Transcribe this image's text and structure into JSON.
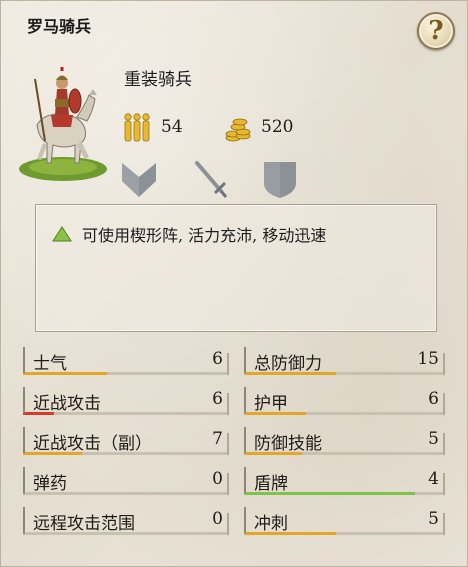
{
  "title": "罗马骑兵",
  "unit": {
    "name": "重装骑兵",
    "men": "54",
    "cost": "520",
    "class_icons": [
      "chevron-icon",
      "sword-icon",
      "shield-icon"
    ]
  },
  "ability": {
    "text": "可使用楔形阵, 活力充沛, 移动迅速",
    "color": "#7cb342"
  },
  "colors": {
    "bar_default": "#e3a62c",
    "bar_low": "#d93a2a",
    "bar_good": "#7cc44a"
  },
  "stats_left": [
    {
      "label": "士气",
      "value": "6",
      "fill": 0.4,
      "color": "#e3a62c"
    },
    {
      "label": "近战攻击",
      "value": "6",
      "fill": 0.14,
      "color": "#d93a2a"
    },
    {
      "label": "近战攻击（副）",
      "value": "7",
      "fill": 0.28,
      "color": "#e3a62c"
    },
    {
      "label": "弹药",
      "value": "0",
      "fill": 0.0,
      "color": "#e3a62c"
    },
    {
      "label": "远程攻击范围",
      "value": "0",
      "fill": 0.0,
      "color": "#e3a62c"
    }
  ],
  "stats_right": [
    {
      "label": "总防御力",
      "value": "15",
      "fill": 0.45,
      "color": "#e3a62c"
    },
    {
      "label": "护甲",
      "value": "6",
      "fill": 0.3,
      "color": "#e3a62c"
    },
    {
      "label": "防御技能",
      "value": "5",
      "fill": 0.28,
      "color": "#e3a62c"
    },
    {
      "label": "盾牌",
      "value": "4",
      "fill": 0.85,
      "color": "#7cc44a"
    },
    {
      "label": "冲刺",
      "value": "5",
      "fill": 0.45,
      "color": "#e3a62c"
    }
  ]
}
